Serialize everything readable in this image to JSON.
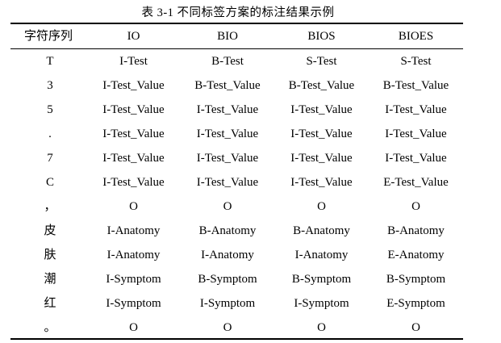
{
  "caption": "表 3-1  不同标签方案的标注结果示例",
  "table": {
    "headers": [
      "字符序列",
      "IO",
      "BIO",
      "BIOS",
      "BIOES"
    ],
    "rows": [
      [
        "T",
        "I-Test",
        "B-Test",
        "S-Test",
        "S-Test"
      ],
      [
        "3",
        "I-Test_Value",
        "B-Test_Value",
        "B-Test_Value",
        "B-Test_Value"
      ],
      [
        "5",
        "I-Test_Value",
        "I-Test_Value",
        "I-Test_Value",
        "I-Test_Value"
      ],
      [
        ".",
        "I-Test_Value",
        "I-Test_Value",
        "I-Test_Value",
        "I-Test_Value"
      ],
      [
        "7",
        "I-Test_Value",
        "I-Test_Value",
        "I-Test_Value",
        "I-Test_Value"
      ],
      [
        "C",
        "I-Test_Value",
        "I-Test_Value",
        "I-Test_Value",
        "E-Test_Value"
      ],
      [
        "，",
        "O",
        "O",
        "O",
        "O"
      ],
      [
        "皮",
        "I-Anatomy",
        "B-Anatomy",
        "B-Anatomy",
        "B-Anatomy"
      ],
      [
        "肤",
        "I-Anatomy",
        "I-Anatomy",
        "I-Anatomy",
        "E-Anatomy"
      ],
      [
        "潮",
        "I-Symptom",
        "B-Symptom",
        "B-Symptom",
        "B-Symptom"
      ],
      [
        "红",
        "I-Symptom",
        "I-Symptom",
        "I-Symptom",
        "E-Symptom"
      ],
      [
        "。",
        "O",
        "O",
        "O",
        "O"
      ]
    ]
  }
}
